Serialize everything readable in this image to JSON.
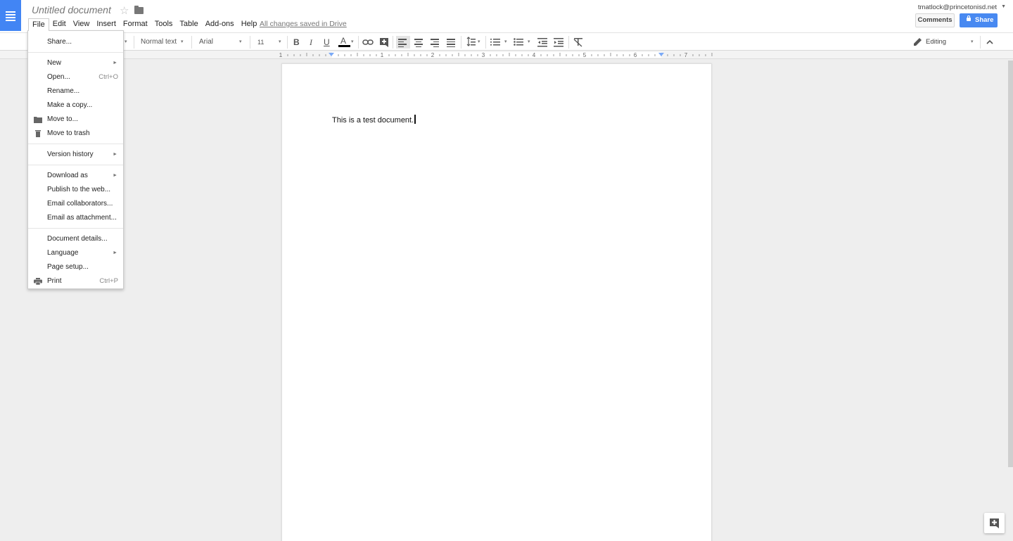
{
  "header": {
    "doc_title": "Untitled document",
    "save_status": "All changes saved in Drive",
    "account": "tmatlock@princetonisd.net",
    "comments_label": "Comments",
    "share_label": "Share"
  },
  "menubar": {
    "file": "File",
    "edit": "Edit",
    "view": "View",
    "insert": "Insert",
    "format": "Format",
    "tools": "Tools",
    "table": "Table",
    "addons": "Add-ons",
    "help": "Help"
  },
  "toolbar": {
    "style": "Normal text",
    "font": "Arial",
    "size": "11",
    "bold": "B",
    "italic": "I",
    "underline": "U",
    "text_color": "A",
    "mode": "Editing"
  },
  "ruler": {
    "labels": [
      "1",
      "1",
      "2",
      "3",
      "4",
      "5",
      "6",
      "7"
    ]
  },
  "document": {
    "body_text": "This is a test document."
  },
  "file_menu": {
    "share": "Share...",
    "new": "New",
    "open": "Open...",
    "open_shortcut": "Ctrl+O",
    "rename": "Rename...",
    "make_copy": "Make a copy...",
    "move_to": "Move to...",
    "move_to_trash": "Move to trash",
    "version_history": "Version history",
    "download_as": "Download as",
    "publish": "Publish to the web...",
    "email_collaborators": "Email collaborators...",
    "email_attachment": "Email as attachment...",
    "document_details": "Document details...",
    "language": "Language",
    "page_setup": "Page setup...",
    "print": "Print",
    "print_shortcut": "Ctrl+P"
  },
  "colors": {
    "brand_blue": "#4285f4",
    "share_blue": "#4889f1",
    "text_color_bar": "#000000"
  }
}
